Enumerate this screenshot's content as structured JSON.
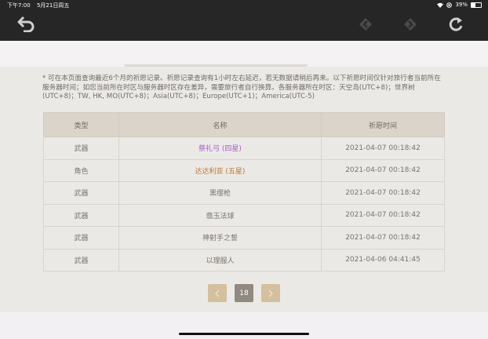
{
  "status": {
    "time": "下午7:00",
    "date": "5月21日周五",
    "battery": "39%",
    "battery_level": 0.39
  },
  "toolbar": {
    "back": "undo-arrow-icon",
    "prev": "diamond-prev-icon",
    "next": "diamond-next-icon",
    "refresh": "refresh-icon"
  },
  "notice": "* 可在本页面查询最近6个月的祈愿记录。祈愿记录查询有1小时左右延迟，若无数据请稍后再来。以下祈愿时间仅针对旅行者当前所在服务器时间；如您当前所在时区与服务器时区存在差异，需要旅行者自行换算。各服务器所在时区：天空岛(UTC+8)；世界树(UTC+8)；TW, HK, MO(UTC+8)；Asia(UTC+8)；Europe(UTC+1)；America(UTC-5)",
  "table": {
    "headers": [
      "类型",
      "名称",
      "祈愿时间"
    ],
    "rows": [
      {
        "type": "武器",
        "name": "祭礼弓 (四星)",
        "time": "2021-04-07 00:18:42",
        "color": "#a25ec4"
      },
      {
        "type": "角色",
        "name": "达达利亚 (五星)",
        "time": "2021-04-07 00:18:42",
        "color": "#bf7224"
      },
      {
        "type": "武器",
        "name": "黑缨枪",
        "time": "2021-04-07 00:18:42",
        "color": "#7a736c"
      },
      {
        "type": "武器",
        "name": "翡玉法球",
        "time": "2021-04-07 00:18:42",
        "color": "#7a736c"
      },
      {
        "type": "武器",
        "name": "神射手之誓",
        "time": "2021-04-07 00:18:42",
        "color": "#7a736c"
      },
      {
        "type": "武器",
        "name": "以理服人",
        "time": "2021-04-06 04:41:45",
        "color": "#7a736c"
      }
    ]
  },
  "pagination": {
    "current": "18",
    "prev_icon": "chevron-left-icon",
    "next_icon": "chevron-right-icon"
  }
}
